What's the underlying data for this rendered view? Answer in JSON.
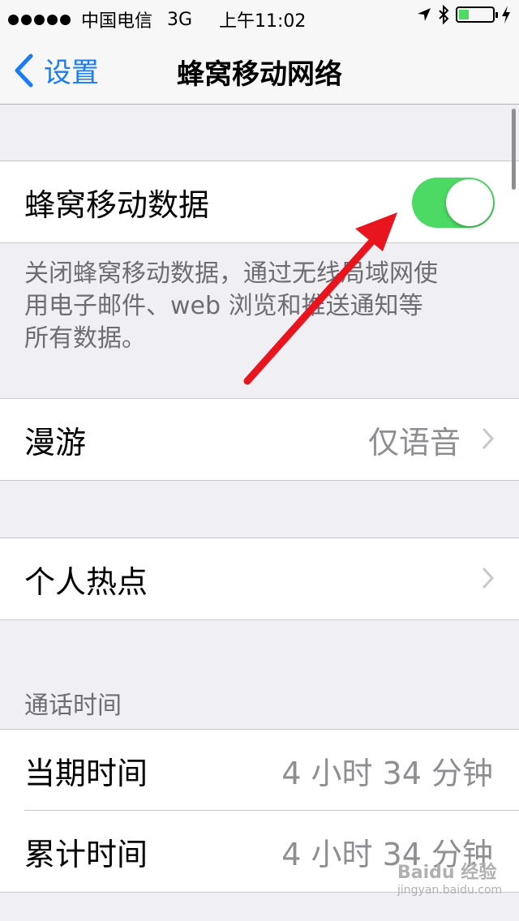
{
  "status_bar": {
    "carrier": "中国电信",
    "network": "3G",
    "time": "上午11:02",
    "battery_color": "#4cd964",
    "battery_level": 0.3
  },
  "nav": {
    "back_label": "设置",
    "title": "蜂窝移动网络",
    "accent": "#1a7cf5"
  },
  "cellular": {
    "label": "蜂窝移动数据",
    "enabled": true,
    "footer_lines": [
      "关闭蜂窝移动数据，通过无线局域网使",
      "用电子邮件、web 浏览和推送通知等",
      "所有数据。"
    ]
  },
  "roaming": {
    "label": "漫游",
    "value": "仅语音"
  },
  "hotspot": {
    "label": "个人热点"
  },
  "call_time": {
    "header": "通话时间",
    "rows": [
      {
        "label": "当期时间",
        "value": "4 小时 34 分钟"
      },
      {
        "label": "累计时间",
        "value": "4 小时 34 分钟"
      }
    ]
  },
  "watermark": {
    "line1": "Baidu 经验",
    "line2": "jingyan.baidu.com"
  }
}
